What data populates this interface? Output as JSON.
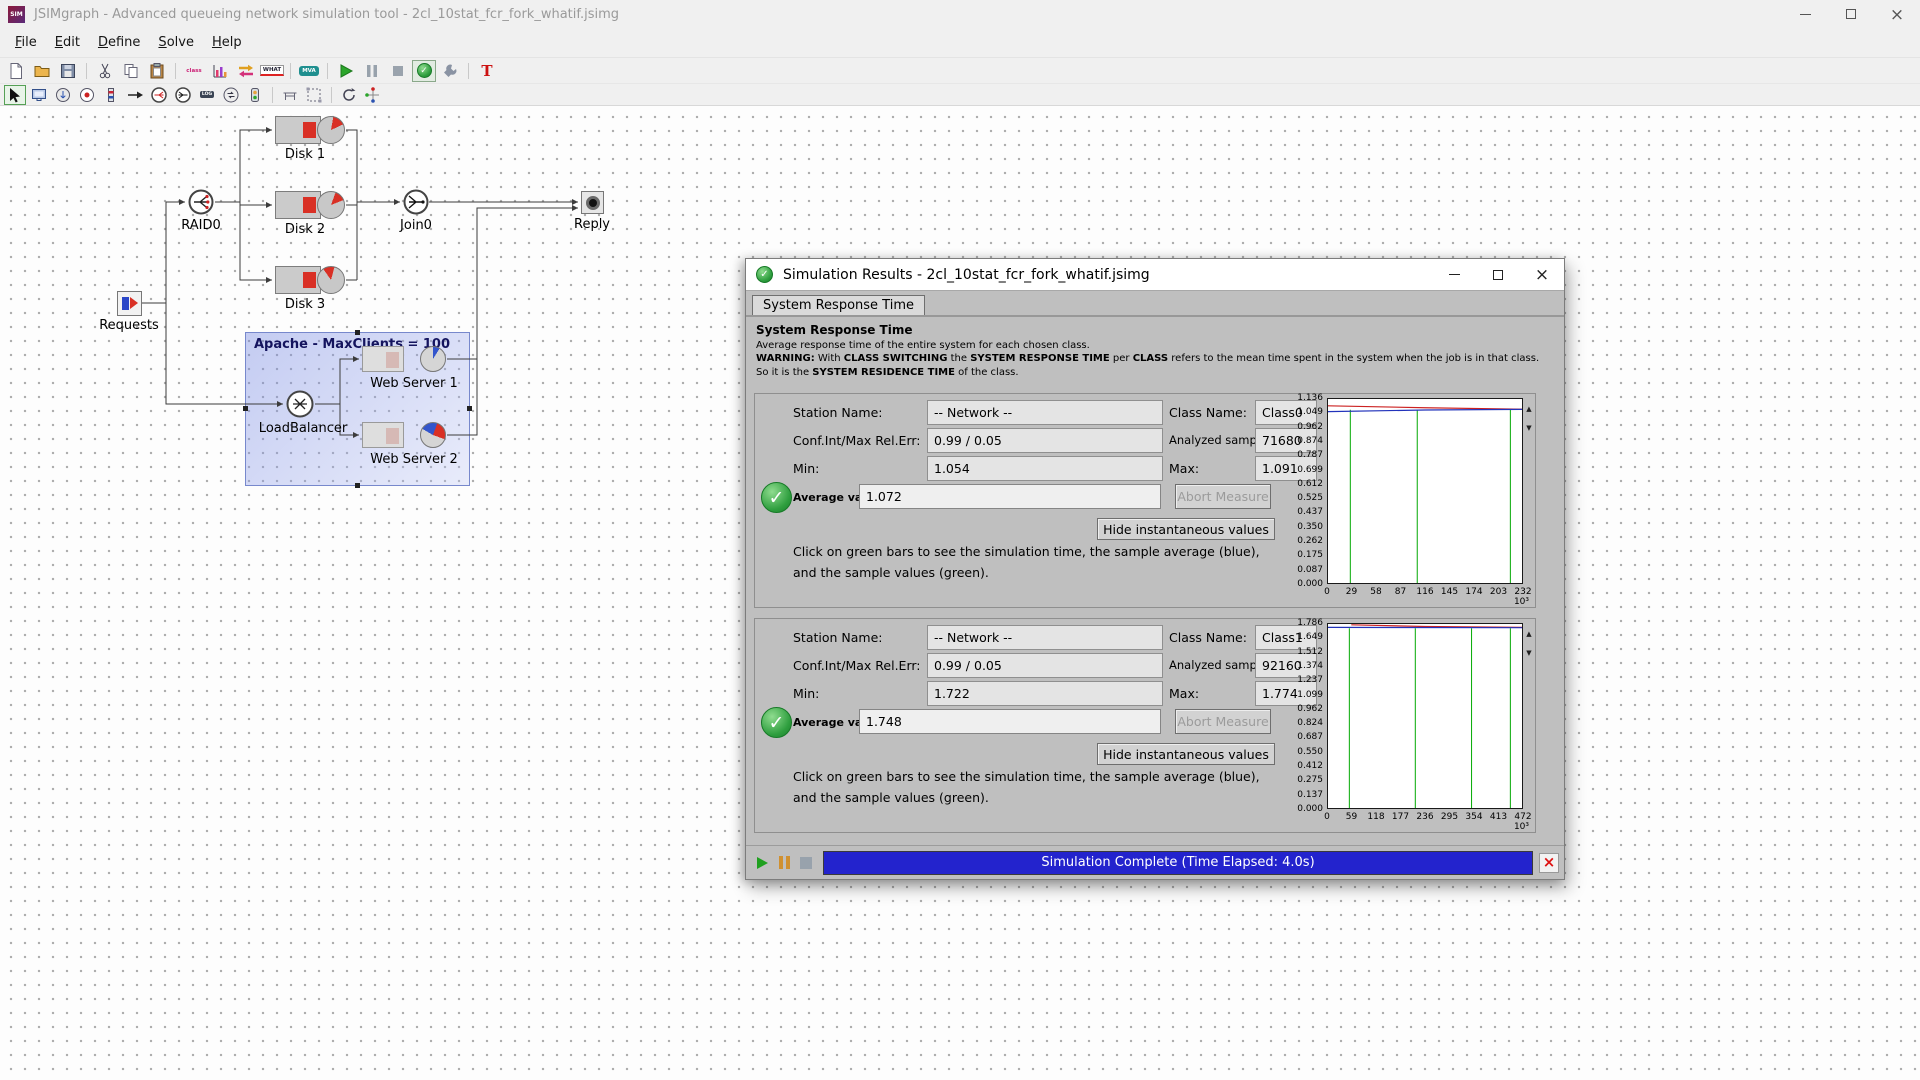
{
  "window": {
    "title": "JSIMgraph - Advanced queueing network simulation tool - 2cl_10stat_fcr_fork_whatif.jsimg",
    "icon_text": "SIM"
  },
  "menu": {
    "items": [
      "File",
      "Edit",
      "Define",
      "Solve",
      "Help"
    ]
  },
  "toolbar_main": {
    "icons": [
      "new-file",
      "open-file",
      "save",
      "cut",
      "copy",
      "paste",
      "edit-classes",
      "edit-measures",
      "exchange-results",
      "what-if-analysis",
      "mva-solver",
      "start-simulation",
      "pause-simulation",
      "stop-simulation",
      "show-simulation-results",
      "define-parameters",
      "insert-text"
    ],
    "glyphs": {
      "classes": "class",
      "whatif": "WHAT",
      "mva": "MVA",
      "text": "T"
    }
  },
  "toolbar_draw": {
    "icons": [
      "select-tool",
      "add-station",
      "add-source",
      "add-sink",
      "add-delay",
      "add-link",
      "add-fork",
      "add-join",
      "add-logger",
      "add-class-switch",
      "add-semaphore",
      "add-table",
      "add-region",
      "rotate-component",
      "add-connector"
    ],
    "glyphs": {
      "log": "LOG"
    }
  },
  "canvas": {
    "region_label": "Apache - MaxClients = 100",
    "labels": {
      "requests": "Requests",
      "raid0": "RAID0",
      "disk1": "Disk 1",
      "disk2": "Disk 2",
      "disk3": "Disk 3",
      "join0": "Join0",
      "reply": "Reply",
      "loadbalancer": "LoadBalancer",
      "webserver1": "Web Server 1",
      "webserver2": "Web Server 2"
    }
  },
  "dialog": {
    "title": "Simulation Results - 2cl_10stat_fcr_fork_whatif.jsimg",
    "tab": "System Response Time",
    "section_title": "System Response Time",
    "description": "Average response time of the entire system for each chosen class.",
    "warning_segments": [
      {
        "t": "WARNING:",
        "b": true
      },
      {
        "t": " With ",
        "b": false
      },
      {
        "t": "CLASS SWITCHING",
        "b": true
      },
      {
        "t": " the ",
        "b": false
      },
      {
        "t": "SYSTEM RESPONSE TIME",
        "b": true
      },
      {
        "t": " per ",
        "b": false
      },
      {
        "t": "CLASS",
        "b": true
      },
      {
        "t": " refers to the mean time spent in the system when the job is in that class. So it is the ",
        "b": false
      },
      {
        "t": "SYSTEM RESIDENCE TIME",
        "b": true
      },
      {
        "t": " of the class.",
        "b": false
      }
    ],
    "hint_line1": "Click on green bars to see the simulation time, the sample average (blue),",
    "hint_line2": "and the sample values (green).",
    "panels": [
      {
        "station_label": "Station Name:",
        "station_value": "-- Network --",
        "class_label": "Class Name:",
        "class_value": "Class0",
        "conf_label": "Conf.Int/Max Rel.Err:",
        "conf_value": "0.99 / 0.05",
        "samples_label": "Analyzed samples:",
        "samples_value": "71680",
        "min_label": "Min:",
        "min_value": "1.054",
        "max_label": "Max:",
        "max_value": "1.091",
        "avg_label": "Average value:",
        "avg_value": "1.072",
        "abort_label": "Abort Measure",
        "hide_label": "Hide instantaneous values",
        "chart": {
          "type": "line",
          "ymax": 1.136,
          "green_top": 1.07,
          "yticks": [
            "1.136",
            "1.049",
            "0.962",
            "0.874",
            "0.787",
            "0.699",
            "0.612",
            "0.525",
            "0.437",
            "0.350",
            "0.262",
            "0.175",
            "0.087",
            "0.000"
          ],
          "xticks": [
            "0",
            "29",
            "58",
            "87",
            "116",
            "145",
            "174",
            "203",
            "232"
          ],
          "xunit": "10³",
          "green_x": [
            0.115,
            0.46,
            0.94
          ],
          "series": [
            {
              "name": "instantaneous",
              "color": "#cc2222",
              "points": [
                [
                  0,
                  1.094
                ],
                [
                  0.5,
                  1.082
                ],
                [
                  1,
                  1.073
                ]
              ]
            },
            {
              "name": "sample-average",
              "color": "#2233bb",
              "points": [
                [
                  0,
                  1.058
                ],
                [
                  0.5,
                  1.068
                ],
                [
                  1,
                  1.072
                ]
              ]
            }
          ]
        }
      },
      {
        "station_label": "Station Name:",
        "station_value": "-- Network --",
        "class_label": "Class Name:",
        "class_value": "Class1",
        "conf_label": "Conf.Int/Max Rel.Err:",
        "conf_value": "0.99 / 0.05",
        "samples_label": "Analyzed samples:",
        "samples_value": "92160",
        "min_label": "Min:",
        "min_value": "1.722",
        "max_label": "Max:",
        "max_value": "1.774",
        "avg_label": "Average value:",
        "avg_value": "1.748",
        "abort_label": "Abort Measure",
        "hide_label": "Hide instantaneous values",
        "chart": {
          "type": "line",
          "ymax": 1.786,
          "green_top": 1.745,
          "yticks": [
            "1.786",
            "1.649",
            "1.512",
            "1.374",
            "1.237",
            "1.099",
            "0.962",
            "0.824",
            "0.687",
            "0.550",
            "0.412",
            "0.275",
            "0.137",
            "0.000"
          ],
          "xticks": [
            "0",
            "59",
            "118",
            "177",
            "236",
            "295",
            "354",
            "413",
            "472"
          ],
          "xunit": "10³",
          "green_x": [
            0.11,
            0.45,
            0.74,
            0.94
          ],
          "series": [
            {
              "name": "instantaneous",
              "color": "#cc2222",
              "points": [
                [
                  0.12,
                  1.778
                ],
                [
                  0.5,
                  1.762
                ],
                [
                  1,
                  1.753
                ]
              ]
            },
            {
              "name": "sample-average",
              "color": "#2233bb",
              "points": [
                [
                  0,
                  1.753
                ],
                [
                  1,
                  1.75
                ]
              ]
            }
          ]
        }
      }
    ],
    "status": {
      "progress_text": "Simulation Complete (Time Elapsed: 4.0s)"
    }
  }
}
